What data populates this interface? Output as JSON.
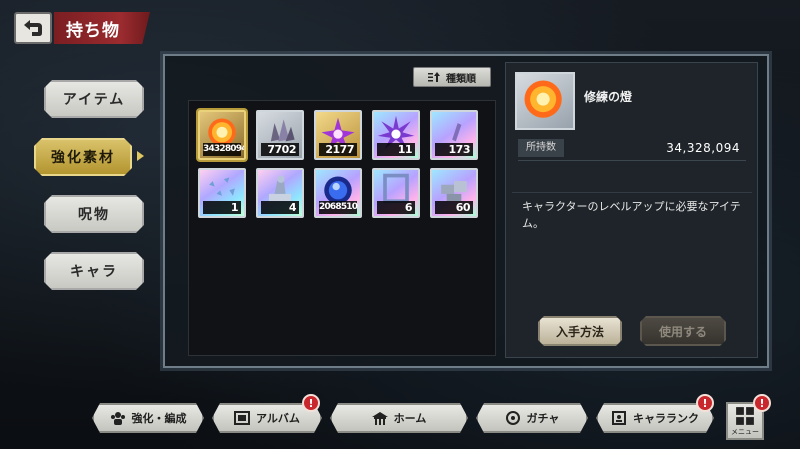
{
  "header": {
    "title": "持ち物"
  },
  "side_tabs": [
    {
      "label": "アイテム",
      "active": false
    },
    {
      "label": "強化素材",
      "active": true
    },
    {
      "label": "呪物",
      "active": false
    },
    {
      "label": "キャラ",
      "active": false
    }
  ],
  "sort": {
    "label": "種類順"
  },
  "items": [
    {
      "name": "修練の燈",
      "count": "34328094",
      "frame": "selected",
      "icon": "orange-flame-orb-icon"
    },
    {
      "name": "gray-crystal",
      "count": "7702",
      "frame": "gray",
      "icon": "gray-crystal-cluster-icon"
    },
    {
      "name": "gold-crystal",
      "count": "2177",
      "frame": "gold",
      "icon": "purple-crystal-burst-icon"
    },
    {
      "name": "rainbow-crystal",
      "count": "11",
      "frame": "rainbow",
      "icon": "crystal-explosion-icon"
    },
    {
      "name": "rainbow-shard",
      "count": "173",
      "frame": "rainbow",
      "icon": "crystal-shard-icon"
    },
    {
      "name": "rainbow-fragments",
      "count": "1",
      "frame": "rainbow2",
      "icon": "scattered-fragments-icon"
    },
    {
      "name": "rainbow-statue",
      "count": "4",
      "frame": "rainbow2",
      "icon": "ice-statue-icon"
    },
    {
      "name": "blue-orb",
      "count": "2068510",
      "frame": "rainbow",
      "icon": "blue-orb-icon"
    },
    {
      "name": "rainbow-gate",
      "count": "6",
      "frame": "rainbow",
      "icon": "crystal-gate-icon"
    },
    {
      "name": "rainbow-blocks",
      "count": "60",
      "frame": "rainbow",
      "icon": "stone-blocks-icon"
    }
  ],
  "detail": {
    "name": "修練の燈",
    "owned_label": "所持数",
    "owned_value": "34,328,094",
    "description": "キャラクターのレベルアップに必要なアイテム。",
    "acquire_label": "入手方法",
    "use_label": "使用する"
  },
  "bottom_nav": [
    {
      "label": "強化・編成",
      "icon": "party-icon",
      "badge": ""
    },
    {
      "label": "アルバム",
      "icon": "album-icon",
      "badge": "!"
    },
    {
      "label": "ホーム",
      "icon": "home-icon",
      "badge": ""
    },
    {
      "label": "ガチャ",
      "icon": "gacha-icon",
      "badge": ""
    },
    {
      "label": "キャラランク",
      "icon": "character-rank-icon",
      "badge": "!"
    }
  ],
  "menu": {
    "label": "メニュー",
    "badge": "!"
  }
}
